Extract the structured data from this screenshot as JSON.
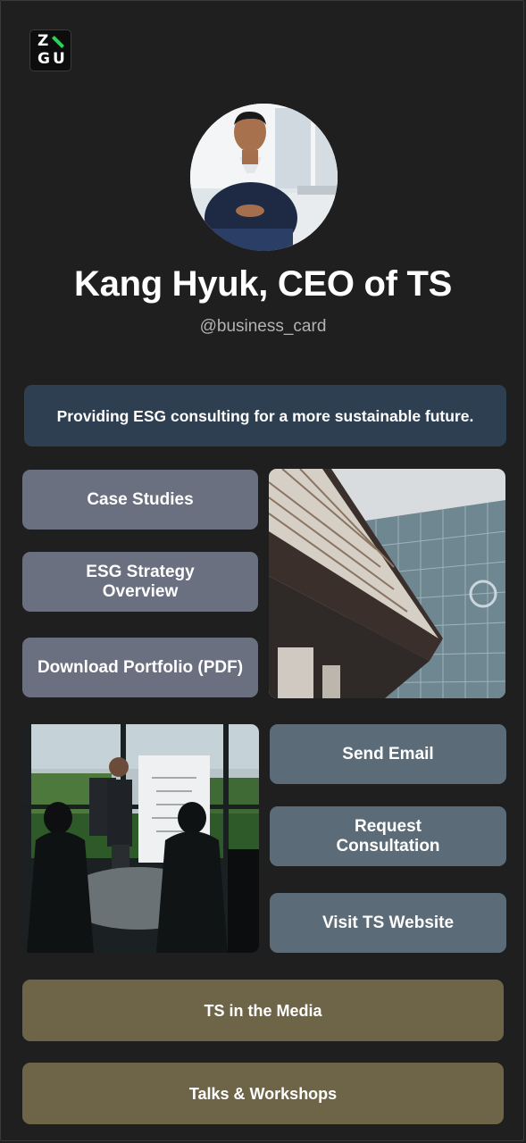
{
  "logo": {
    "letters": [
      "Z",
      "G",
      "U"
    ],
    "accent": "#2fd05a"
  },
  "profile": {
    "name": "Kang Hyuk, CEO of TS",
    "handle": "@business_card",
    "tagline": "Providing ESG consulting for a more sustainable future."
  },
  "links_left": [
    {
      "label": "Case Studies"
    },
    {
      "label": "ESG Strategy Overview"
    },
    {
      "label": "Download Portfolio (PDF)"
    }
  ],
  "links_right": [
    {
      "label": "Send Email"
    },
    {
      "label": "Request Consultation"
    },
    {
      "label": "Visit TS Website"
    }
  ],
  "links_bottom": [
    {
      "label": "TS in the Media"
    },
    {
      "label": "Talks & Workshops"
    }
  ],
  "colors": {
    "background": "#1f1f1f",
    "tagline_bg": "#2e3f52",
    "grey_btn": "#6b7080",
    "slate_btn": "#5b6c78",
    "olive_btn": "#6e6548"
  }
}
